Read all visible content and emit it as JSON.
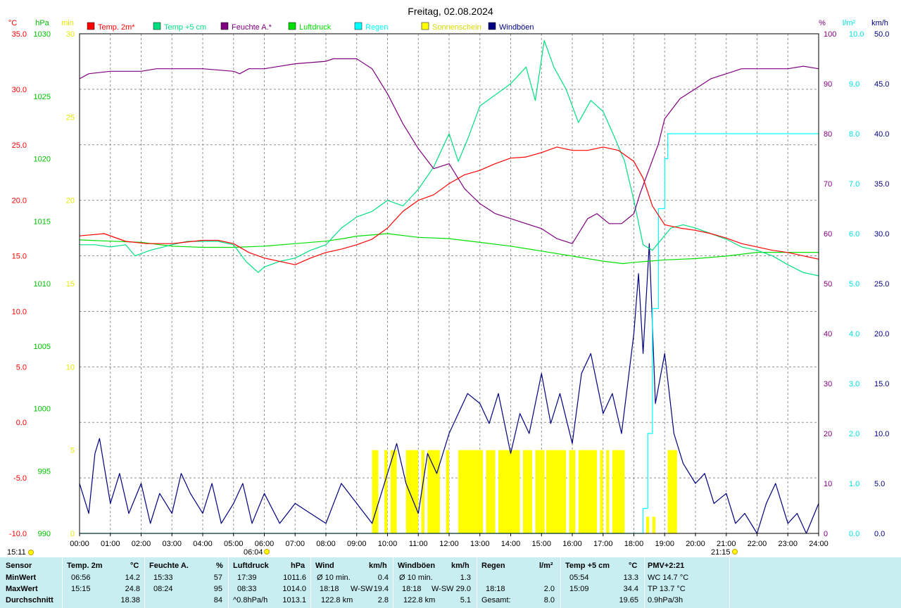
{
  "chart_data": {
    "type": "line",
    "title": "Freitag, 02.08.2024",
    "x_tick_labels": [
      "00:00",
      "01:00",
      "02:00",
      "03:00",
      "04:00",
      "05:00",
      "06:00",
      "07:00",
      "08:00",
      "09:00",
      "10:00",
      "11:00",
      "12:00",
      "13:00",
      "14:00",
      "15:00",
      "16:00",
      "17:00",
      "18:00",
      "19:00",
      "20:00",
      "21:00",
      "22:00",
      "23:00",
      "24:00"
    ],
    "xlim_hours": [
      0,
      24
    ],
    "grid": true,
    "legend_position": "top",
    "axes": {
      "temp": {
        "unit_label": "°C",
        "range": [
          -10,
          35
        ],
        "ticks": [
          "35.0",
          "30.0",
          "25.0",
          "20.0",
          "15.0",
          "10.0",
          "5.0",
          "0.0",
          "-5.0",
          "-10.0"
        ],
        "color": "#ff0000"
      },
      "pressure": {
        "unit_label": "hPa",
        "range": [
          990,
          1030
        ],
        "ticks": [
          "1030",
          "1025",
          "1020",
          "1015",
          "1010",
          "1005",
          "1000",
          "995",
          "990"
        ],
        "color": "#00c000"
      },
      "sun": {
        "unit_label": "min",
        "range": [
          0,
          30
        ],
        "ticks": [
          "30",
          "25",
          "20",
          "15",
          "10",
          "5",
          "0"
        ],
        "color": "#e8e800"
      },
      "humidity": {
        "unit_label": "%",
        "range": [
          0,
          100
        ],
        "ticks": [
          "100",
          "90",
          "80",
          "70",
          "60",
          "50",
          "40",
          "30",
          "20",
          "10",
          "0"
        ],
        "color": "#800080"
      },
      "rain": {
        "unit_label": "l/m²",
        "range": [
          0,
          10
        ],
        "ticks": [
          "10.0",
          "9.0",
          "8.0",
          "7.0",
          "6.0",
          "5.0",
          "4.0",
          "3.0",
          "2.0",
          "1.0",
          "0.0"
        ],
        "color": "#00e0e0"
      },
      "wind": {
        "unit_label": "km/h",
        "range": [
          0,
          50
        ],
        "ticks": [
          "50.0",
          "45.0",
          "40.0",
          "35.0",
          "30.0",
          "25.0",
          "20.0",
          "15.0",
          "10.0",
          "5.0",
          "0.0"
        ],
        "color": "#000080"
      }
    },
    "legend": [
      {
        "name": "Temp. 2m*",
        "color": "#ff0000"
      },
      {
        "name": "Temp +5 cm",
        "color": "#00e080"
      },
      {
        "name": "Feuchte A.*",
        "color": "#800080"
      },
      {
        "name": "Luftdruck",
        "color": "#00e000"
      },
      {
        "name": "Regen",
        "color": "#00ffff"
      },
      {
        "name": "Sonnenschein",
        "color": "#ffff00"
      },
      {
        "name": "Windböen",
        "color": "#000080"
      }
    ],
    "series": [
      {
        "name": "Temp. 2m*",
        "axis": "temp",
        "color": "#ff0000",
        "x": [
          0,
          0.8,
          1.5,
          2.2,
          3,
          4,
          4.5,
          5,
          5.5,
          6,
          6.5,
          7,
          7.5,
          8,
          8.5,
          9,
          9.5,
          10,
          10.5,
          11,
          11.5,
          12,
          12.5,
          13,
          13.5,
          14,
          14.5,
          15,
          15.5,
          16,
          16.5,
          17,
          17.5,
          18,
          18.3,
          18.6,
          19,
          19.5,
          20,
          20.5,
          21,
          21.5,
          22,
          22.5,
          23,
          23.5,
          24
        ],
        "y": [
          16.8,
          17.0,
          16.3,
          16.1,
          16.1,
          16.4,
          16.4,
          16.1,
          15.3,
          14.8,
          14.5,
          14.2,
          14.8,
          15.3,
          15.6,
          16.0,
          16.5,
          17.5,
          19.0,
          20.0,
          20.5,
          21.5,
          22.3,
          22.7,
          23.3,
          23.8,
          23.9,
          24.3,
          24.8,
          24.5,
          24.5,
          24.8,
          24.5,
          23.5,
          22.0,
          19.5,
          17.8,
          17.5,
          17.3,
          17.0,
          16.6,
          16.1,
          15.8,
          15.5,
          15.3,
          15.0,
          14.7
        ]
      },
      {
        "name": "Temp +5 cm",
        "axis": "temp",
        "color": "#00e080",
        "x": [
          0,
          0.5,
          1,
          1.5,
          1.8,
          2.3,
          3,
          3.5,
          4,
          4.5,
          5,
          5.4,
          5.8,
          6,
          6.5,
          7,
          7.5,
          8,
          8.5,
          9,
          9.5,
          10,
          10.5,
          11,
          11.5,
          12,
          12.3,
          12.6,
          13,
          13.5,
          14,
          14.5,
          14.8,
          15.09,
          15.4,
          15.8,
          16.2,
          16.6,
          17,
          17.4,
          17.7,
          18,
          18.3,
          18.6,
          18.9,
          19.2,
          19.6,
          20,
          20.5,
          21,
          21.5,
          22,
          22.5,
          23,
          23.5,
          24
        ],
        "y": [
          16.0,
          16.0,
          15.8,
          16.0,
          15.0,
          15.5,
          16.0,
          16.3,
          16.3,
          16.3,
          16.0,
          14.5,
          13.5,
          14.0,
          14.5,
          14.8,
          15.5,
          16.0,
          17.5,
          18.5,
          19.0,
          20.0,
          19.5,
          21.0,
          23.0,
          26.0,
          23.5,
          25.5,
          28.5,
          29.5,
          30.5,
          32.0,
          29.0,
          34.4,
          32.0,
          30.0,
          27.0,
          29.0,
          28.0,
          25.5,
          23.5,
          20.0,
          16.0,
          15.5,
          16.5,
          17.5,
          17.8,
          17.5,
          17.0,
          16.5,
          15.8,
          15.5,
          15.0,
          14.2,
          13.5,
          13.2
        ]
      },
      {
        "name": "Feuchte A.*",
        "axis": "humidity",
        "color": "#800080",
        "x": [
          0,
          0.3,
          1,
          2,
          2.5,
          3,
          4,
          5,
          5.2,
          5.5,
          6,
          7,
          8,
          8.24,
          9,
          9.5,
          10,
          10.5,
          11,
          11.5,
          12,
          12.5,
          13,
          13.5,
          14,
          14.5,
          15,
          15.5,
          16,
          16.5,
          16.8,
          17.2,
          17.6,
          18,
          18.2,
          18.5,
          18.8,
          19,
          19.5,
          20,
          20.5,
          21,
          21.5,
          22,
          22.5,
          23,
          23.5,
          24
        ],
        "y": [
          91,
          92,
          92.5,
          92.5,
          93,
          93,
          93,
          92.5,
          92,
          93,
          93,
          94,
          94.5,
          95,
          95,
          93,
          88,
          82,
          77,
          73,
          74,
          69,
          66,
          64,
          63,
          62,
          61,
          59,
          58,
          63,
          64,
          62,
          62,
          64,
          68,
          73,
          78,
          83,
          87,
          89,
          91,
          92,
          93,
          93,
          93,
          93,
          93.5,
          93
        ]
      },
      {
        "name": "Luftdruck",
        "axis": "pressure",
        "color": "#00e000",
        "x": [
          0,
          1,
          2,
          3,
          4,
          5,
          6,
          7,
          8,
          8.55,
          9,
          10,
          11,
          12,
          13,
          14,
          15,
          16,
          17,
          17.65,
          18,
          18.5,
          19,
          20,
          21,
          22,
          23,
          24
        ],
        "y": [
          1013.5,
          1013.4,
          1013.3,
          1013.0,
          1012.9,
          1012.9,
          1013.0,
          1013.2,
          1013.4,
          1013.6,
          1013.8,
          1014.0,
          1013.7,
          1013.6,
          1013.3,
          1013.0,
          1012.6,
          1012.2,
          1011.8,
          1011.6,
          1011.7,
          1011.8,
          1011.9,
          1012.0,
          1012.2,
          1012.5,
          1012.5,
          1012.5
        ]
      },
      {
        "name": "Regen",
        "axis": "rain",
        "color": "#00ffff",
        "x": [
          0,
          18.2,
          18.3,
          18.45,
          18.6,
          18.8,
          19.0,
          19.1,
          24
        ],
        "y": [
          0,
          0,
          0.5,
          2.0,
          4.5,
          6.5,
          7.5,
          8.0,
          8.0
        ]
      },
      {
        "name": "Windböen",
        "axis": "wind",
        "color": "#000080",
        "x": [
          0,
          0.3,
          0.5,
          0.65,
          1,
          1.3,
          1.6,
          2,
          2.3,
          2.6,
          3,
          3.3,
          3.6,
          4,
          4.3,
          4.6,
          5,
          5.3,
          5.6,
          6,
          6.5,
          7,
          7.5,
          8,
          8.5,
          9,
          9.5,
          10,
          10.3,
          10.6,
          11,
          11.3,
          11.6,
          12,
          12.3,
          12.6,
          13,
          13.3,
          13.6,
          14,
          14.3,
          14.6,
          15,
          15.3,
          15.6,
          16,
          16.3,
          16.6,
          17,
          17.3,
          17.6,
          18,
          18.15,
          18.3,
          18.5,
          18.7,
          19,
          19.3,
          19.6,
          20,
          20.3,
          20.6,
          21,
          21.3,
          21.6,
          22,
          22.3,
          22.6,
          23,
          23.3,
          23.6,
          24
        ],
        "y": [
          5,
          2,
          8,
          9.5,
          3,
          6,
          2,
          5,
          1,
          4,
          2,
          6,
          4,
          2,
          5,
          1,
          3,
          5,
          1,
          4,
          1,
          3,
          2,
          1,
          5,
          3,
          1,
          6,
          9,
          5,
          2,
          8,
          6,
          10,
          12,
          14,
          13,
          11,
          14,
          8,
          12,
          10,
          16,
          11,
          14,
          9,
          16,
          18,
          12,
          14,
          10,
          20,
          26,
          18,
          29.0,
          13,
          18,
          10,
          7,
          5,
          6,
          3,
          4,
          1,
          2,
          0,
          3,
          5,
          1,
          2,
          0,
          3
        ]
      }
    ],
    "sunshine": {
      "axis": "sun",
      "unit": "min",
      "color": "#ffff00",
      "bars": [
        [
          9.5,
          9.7,
          5
        ],
        [
          9.9,
          10.0,
          5
        ],
        [
          10.1,
          10.3,
          5
        ],
        [
          10.6,
          11.0,
          5
        ],
        [
          11.1,
          11.2,
          5
        ],
        [
          11.3,
          11.7,
          5
        ],
        [
          11.9,
          12.0,
          5
        ],
        [
          12.3,
          13.1,
          5
        ],
        [
          13.2,
          13.5,
          5
        ],
        [
          13.6,
          14.3,
          5
        ],
        [
          14.4,
          14.7,
          5
        ],
        [
          14.8,
          15.1,
          5
        ],
        [
          15.15,
          15.8,
          5
        ],
        [
          15.9,
          16.1,
          5
        ],
        [
          16.2,
          16.8,
          5
        ],
        [
          16.9,
          17.0,
          5
        ],
        [
          17.1,
          17.2,
          5
        ],
        [
          17.3,
          17.7,
          5
        ],
        [
          18.4,
          18.5,
          1
        ],
        [
          18.6,
          18.7,
          1
        ],
        [
          19.1,
          19.4,
          5
        ]
      ]
    }
  },
  "sun_markers": {
    "sunrise": "06:04",
    "sunset": "21:15",
    "bottom_left": "15:11"
  },
  "footer": {
    "sensor": {
      "header": "Sensor",
      "rows": [
        "MinWert",
        "MaxWert",
        "Durchschnitt"
      ]
    },
    "temp2m": {
      "header": "Temp. 2m",
      "unit": "°C",
      "min_time": "06:56",
      "min_val": "14.2",
      "max_time": "15:15",
      "max_val": "24.8",
      "avg": "18.38"
    },
    "feuchte": {
      "header": "Feuchte A.",
      "unit": "%",
      "min_time": "15:33",
      "min_val": "57",
      "max_time": "08:24",
      "max_val": "95",
      "avg": "84"
    },
    "luftdruck": {
      "header": "Luftdruck",
      "unit": "hPa",
      "min_time": "17:39",
      "min_val": "1011.6",
      "max_time": "08:33",
      "max_val": "1014.0",
      "avg_label": "^0.8hPa/h",
      "avg": "1013.1"
    },
    "wind": {
      "header": "Wind",
      "unit": "km/h",
      "r1_label": "Ø 10 min.",
      "r1_val": "0.4",
      "r2_time": "18:18",
      "r2_dir": "W-SW",
      "r2_val": "19.4",
      "r3_dist": "122.8 km",
      "r3_val": "2.8"
    },
    "boeen": {
      "header": "Windböen",
      "unit": "km/h",
      "r1_label": "Ø 10 min.",
      "r1_val": "1.3",
      "r2_time": "18:18",
      "r2_dir": "W-SW",
      "r2_val": "29.0",
      "r3_dist": "122.8 km",
      "r3_val": "5.1"
    },
    "regen": {
      "header": "Regen",
      "unit": "l/m²",
      "r2_time": "18:18",
      "r2_val": "2.0",
      "r3_label": "Gesamt:",
      "r3_val": "8.0"
    },
    "temp5": {
      "header": "Temp +5 cm",
      "unit": "°C",
      "min_time": "05:54",
      "min_val": "13.3",
      "max_time": "15:09",
      "max_val": "34.4",
      "avg": "19.65"
    },
    "pmv": {
      "header": "PMV+2:21",
      "r1": "WC 14.7 °C",
      "r2": "TP 13.7 °C",
      "r3": "0.9hPa/3h"
    }
  }
}
